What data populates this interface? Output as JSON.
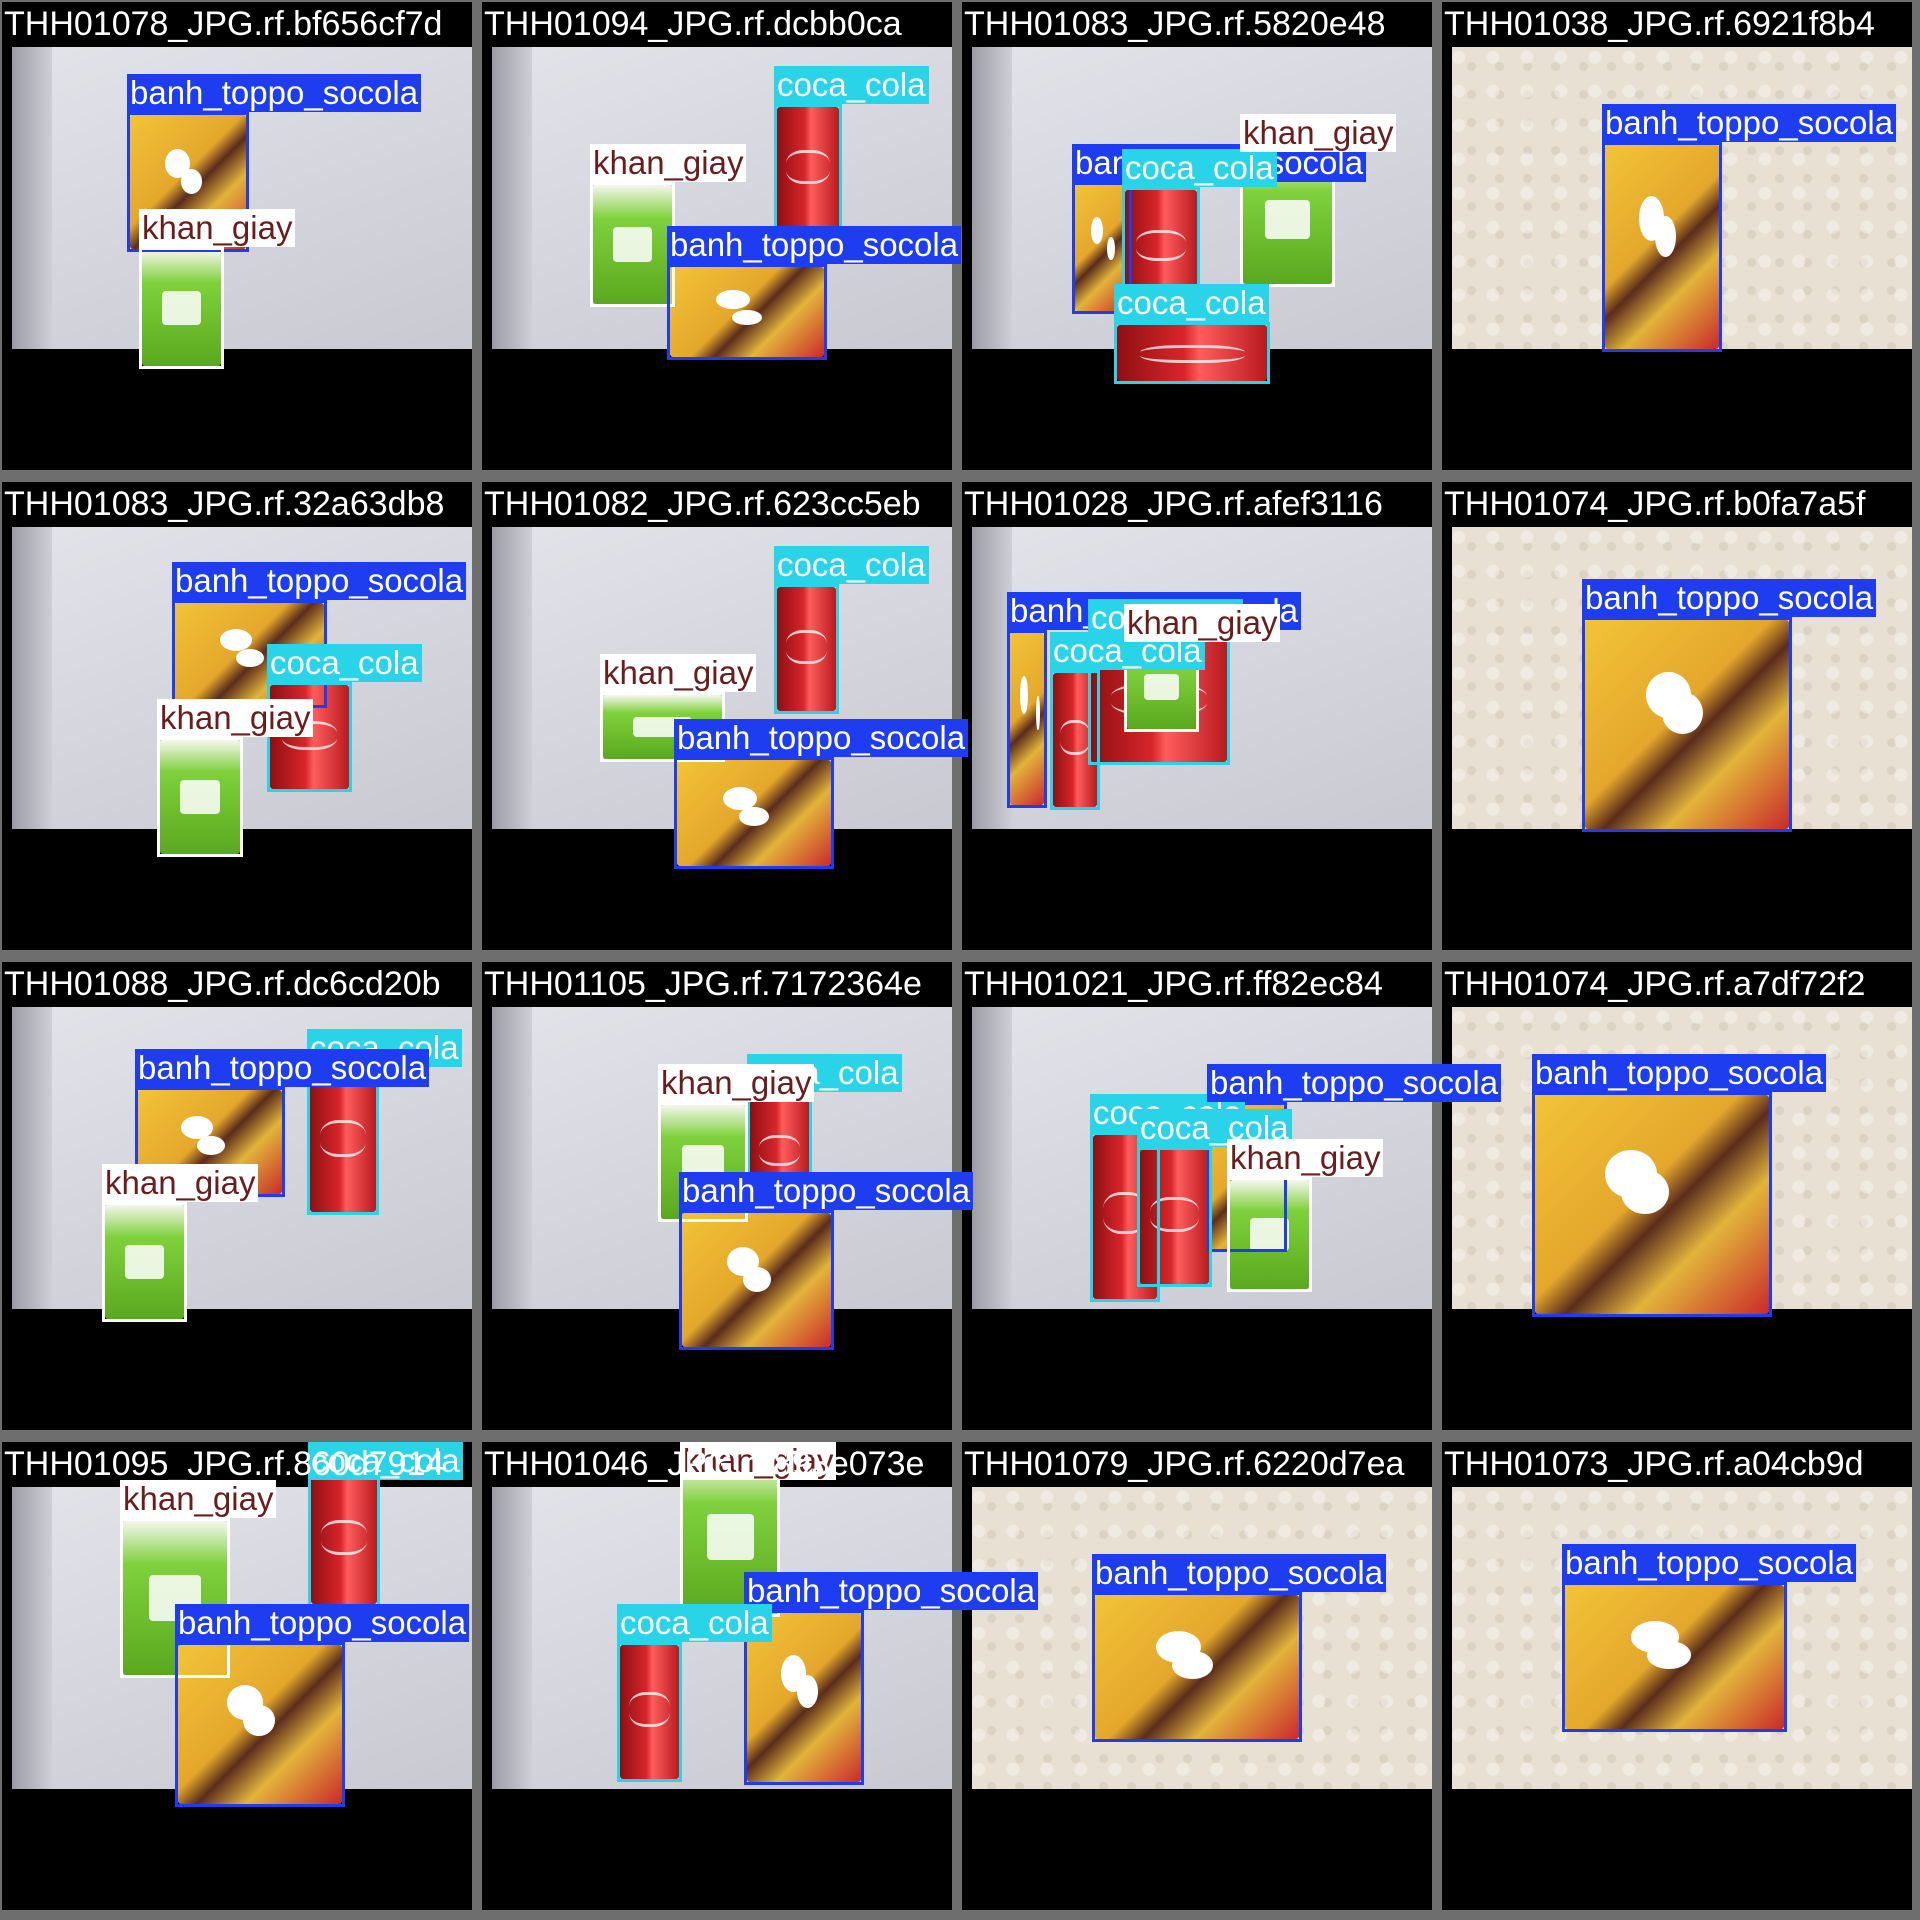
{
  "classes": {
    "banh_toppo_socola": {
      "label": "banh_toppo_socola",
      "color": "#1f3df0",
      "text_color": "#ffffff"
    },
    "coca_cola": {
      "label": "coca_cola",
      "color": "#29d4e8",
      "text_color": "#ffffff"
    },
    "khan_giay": {
      "label": "khan_giay",
      "color": "#ffffff",
      "text_color": "#6b1c1c"
    }
  },
  "tiles": [
    {
      "caption": "THH01078_JPG.rf.bf656cf7d",
      "bg": "box",
      "detections": [
        "banh_toppo_socola",
        "khan_giay"
      ]
    },
    {
      "caption": "THH01094_JPG.rf.dcbb0ca",
      "bg": "box",
      "detections": [
        "coca_cola",
        "khan_giay",
        "banh_toppo_socola"
      ]
    },
    {
      "caption": "THH01083_JPG.rf.5820e48",
      "bg": "box",
      "detections": [
        "banh_toppo_socola",
        "coca_cola",
        "khan_giay",
        "coca_cola"
      ]
    },
    {
      "caption": "THH01038_JPG.rf.6921f8b4",
      "bg": "cloth",
      "detections": [
        "banh_toppo_socola"
      ]
    },
    {
      "caption": "THH01083_JPG.rf.32a63db8",
      "bg": "box",
      "detections": [
        "banh_toppo_socola",
        "coca_cola",
        "khan_giay"
      ]
    },
    {
      "caption": "THH01082_JPG.rf.623cc5eb",
      "bg": "box",
      "detections": [
        "coca_cola",
        "khan_giay",
        "banh_toppo_socola"
      ]
    },
    {
      "caption": "THH01028_JPG.rf.afef3116",
      "bg": "box",
      "detections": [
        "banh_toppo_socola",
        "coca_cola",
        "coca_cola",
        "khan_giay"
      ]
    },
    {
      "caption": "THH01074_JPG.rf.b0fa7a5f",
      "bg": "cloth",
      "detections": [
        "banh_toppo_socola"
      ]
    },
    {
      "caption": "THH01088_JPG.rf.dc6cd20b",
      "bg": "box",
      "detections": [
        "coca_cola",
        "banh_toppo_socola",
        "khan_giay"
      ]
    },
    {
      "caption": "THH01105_JPG.rf.7172364e",
      "bg": "box",
      "detections": [
        "coca_cola",
        "khan_giay",
        "banh_toppo_socola"
      ]
    },
    {
      "caption": "THH01021_JPG.rf.ff82ec84",
      "bg": "box",
      "detections": [
        "coca_cola",
        "banh_toppo_socola",
        "coca_cola",
        "khan_giay"
      ]
    },
    {
      "caption": "THH01074_JPG.rf.a7df72f2",
      "bg": "cloth",
      "detections": [
        "banh_toppo_socola"
      ]
    },
    {
      "caption": "THH01095_JPG.rf.860d7914",
      "bg": "box",
      "detections": [
        "coca_cola",
        "khan_giay",
        "banh_toppo_socola"
      ]
    },
    {
      "caption": "THH01046_JPG.rf.893e073e",
      "bg": "box",
      "detections": [
        "khan_giay",
        "banh_toppo_socola",
        "coca_cola"
      ]
    },
    {
      "caption": "THH01079_JPG.rf.6220d7ea",
      "bg": "cloth",
      "detections": [
        "banh_toppo_socola"
      ]
    },
    {
      "caption": "THH01073_JPG.rf.a04cb9d",
      "bg": "cloth",
      "detections": [
        "banh_toppo_socola"
      ]
    }
  ]
}
